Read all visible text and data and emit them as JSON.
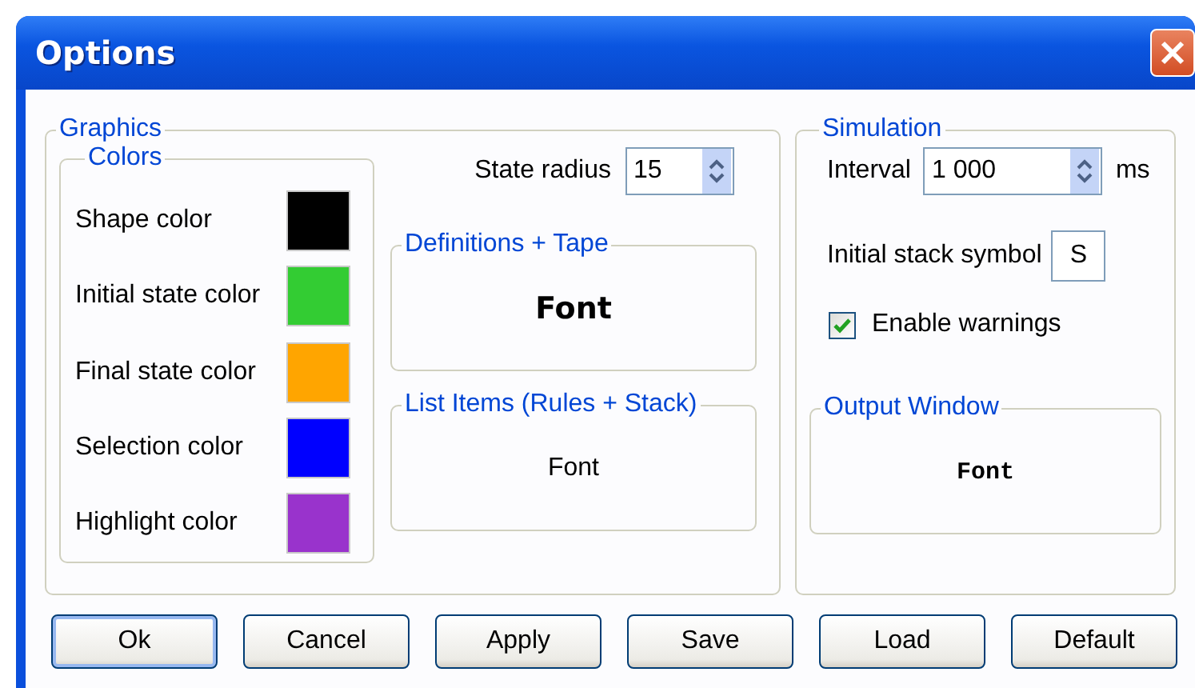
{
  "window": {
    "title": "Options"
  },
  "graphics": {
    "title": "Graphics",
    "colors": {
      "title": "Colors",
      "items": [
        {
          "label": "Shape color",
          "color": "#000000"
        },
        {
          "label": "Initial state color",
          "color": "#33cc33"
        },
        {
          "label": "Final state color",
          "color": "#ffa500"
        },
        {
          "label": "Selection color",
          "color": "#0000ff"
        },
        {
          "label": "Highlight color",
          "color": "#9933cc"
        }
      ]
    },
    "state_radius": {
      "label": "State radius",
      "value": "15"
    },
    "definitions_tape": {
      "title": "Definitions + Tape",
      "preview": "Font",
      "kind": "bold"
    },
    "list_items": {
      "title": "List Items (Rules + Stack)",
      "preview": "Font",
      "kind": "regular"
    }
  },
  "simulation": {
    "title": "Simulation",
    "interval": {
      "label": "Interval",
      "value": "1 000",
      "unit": "ms"
    },
    "stack_symbol": {
      "label": "Initial stack symbol",
      "value": "S"
    },
    "warnings": {
      "label": "Enable warnings",
      "checked": true
    },
    "output_window": {
      "title": "Output Window",
      "preview": "Font",
      "kind": "mono"
    }
  },
  "buttons": [
    {
      "label": "Ok",
      "default": true
    },
    {
      "label": "Cancel",
      "default": false
    },
    {
      "label": "Apply",
      "default": false
    },
    {
      "label": "Save",
      "default": false
    },
    {
      "label": "Load",
      "default": false
    },
    {
      "label": "Default",
      "default": false
    }
  ]
}
